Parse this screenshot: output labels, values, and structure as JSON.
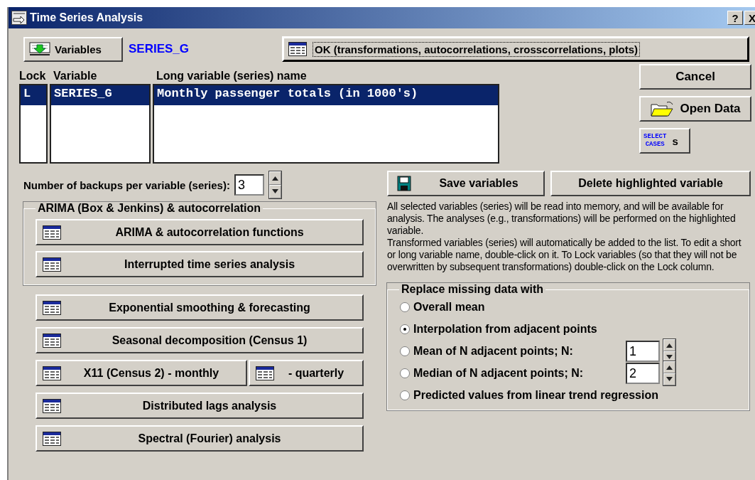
{
  "window": {
    "title": "Time Series Analysis",
    "help_button": "?",
    "close_button": "X"
  },
  "variables_button": "Variables",
  "current_variable": "SERIES_G",
  "ok_button": "OK (transformations, autocorrelations, crosscorrelations, plots)",
  "list": {
    "columns": [
      "Lock",
      "Variable",
      "Long variable (series) name"
    ],
    "rows": [
      {
        "lock": "L",
        "variable": "SERIES_G",
        "long_name": "Monthly passenger totals (in 1000's)",
        "selected": true
      }
    ]
  },
  "side_buttons": {
    "cancel": "Cancel",
    "open_data": "Open Data",
    "select_cases_icon": [
      "SELECT",
      "CASES"
    ],
    "select_cases": "s"
  },
  "backups": {
    "label": "Number of backups per variable (series):",
    "value": "3"
  },
  "save_button": "Save variables",
  "delete_button": "Delete highlighted variable",
  "arima_group": {
    "title": "ARIMA (Box & Jenkins)  & autocorrelation",
    "buttons": [
      "ARIMA & autocorrelation functions",
      "Interrupted time series analysis"
    ]
  },
  "analysis_buttons": [
    {
      "kind": "full",
      "label": "Exponential smoothing & forecasting"
    },
    {
      "kind": "full",
      "label": "Seasonal decomposition (Census 1)"
    },
    {
      "kind": "split",
      "label": "X11 (Census 2) - monthly",
      "second_label": "- quarterly"
    },
    {
      "kind": "full",
      "label": "Distributed lags analysis"
    },
    {
      "kind": "full",
      "label": "Spectral (Fourier) analysis"
    }
  ],
  "description": [
    "All selected variables (series) will be read into memory, and will be available for analysis. The analyses (e.g., transformations) will be performed on the highlighted variable.",
    "Transformed variables (series) will automatically be added to the list. To edit a short or long variable name, double-click on it. To Lock variables (so that they will not be overwritten by subsequent transformations) double-click on the Lock column."
  ],
  "missing_group": {
    "title": "Replace missing data with",
    "options": [
      {
        "label": "Overall mean",
        "selected": false
      },
      {
        "label": "Interpolation from adjacent points",
        "selected": true
      },
      {
        "label": "Mean of N adjacent points; N:",
        "selected": false,
        "value": "1"
      },
      {
        "label": "Median of N adjacent points; N:",
        "selected": false,
        "value": "2"
      },
      {
        "label": "Predicted values from linear trend regression",
        "selected": false
      }
    ]
  }
}
